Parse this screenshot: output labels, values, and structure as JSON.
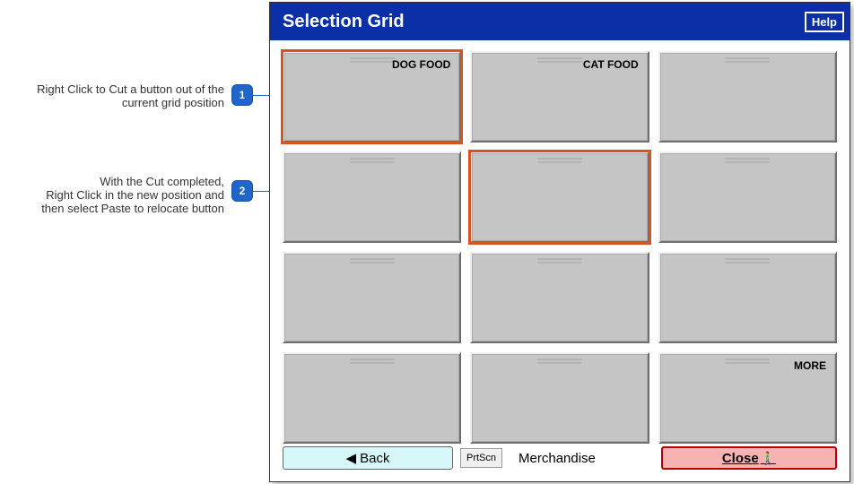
{
  "annotations": [
    {
      "badge": "1",
      "text": "Right Click to Cut a button out of the current grid position"
    },
    {
      "badge": "2",
      "text": "With the Cut completed,\nRight Click in the new position and\nthen select Paste to relocate button"
    }
  ],
  "titlebar": {
    "title": "Selection Grid",
    "help_label": "Help"
  },
  "grid": {
    "tiles": [
      {
        "label": "DOG FOOD",
        "selected": true
      },
      {
        "label": "CAT FOOD",
        "selected": false
      },
      {
        "label": "",
        "selected": false
      },
      {
        "label": "",
        "selected": false
      },
      {
        "label": "",
        "selected": true
      },
      {
        "label": "",
        "selected": false
      },
      {
        "label": "",
        "selected": false
      },
      {
        "label": "",
        "selected": false
      },
      {
        "label": "",
        "selected": false
      },
      {
        "label": "",
        "selected": false
      },
      {
        "label": "",
        "selected": false
      },
      {
        "label": "MORE",
        "selected": false
      }
    ]
  },
  "footer": {
    "back_label": "Back",
    "prtscn_label": "PrtScn",
    "status_label": "Merchandise",
    "close_label": "Close"
  }
}
